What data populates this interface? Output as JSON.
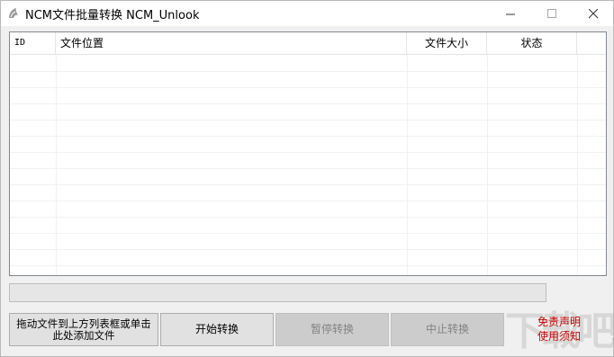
{
  "window": {
    "title": "NCM文件批量转换 NCM_Unlook",
    "minimize_icon": "minimize-icon",
    "maximize_icon": "maximize-icon",
    "close_icon": "close-icon"
  },
  "file_list": {
    "columns": [
      {
        "key": "id",
        "label": "ID"
      },
      {
        "key": "location",
        "label": "文件位置"
      },
      {
        "key": "size",
        "label": "文件大小"
      },
      {
        "key": "status",
        "label": "状态"
      }
    ],
    "rows": []
  },
  "progress": {
    "value": 0,
    "color": "#06b025"
  },
  "buttons": {
    "drop_hint": "拖动文件到上方列表框或单击此处添加文件",
    "start": "开始转换",
    "pause": "暂停转换",
    "stop": "中止转换"
  },
  "disclaimer": {
    "line1": "免责声明",
    "line2": "使用须知",
    "color": "#cc0000"
  },
  "watermark": "下载吧"
}
